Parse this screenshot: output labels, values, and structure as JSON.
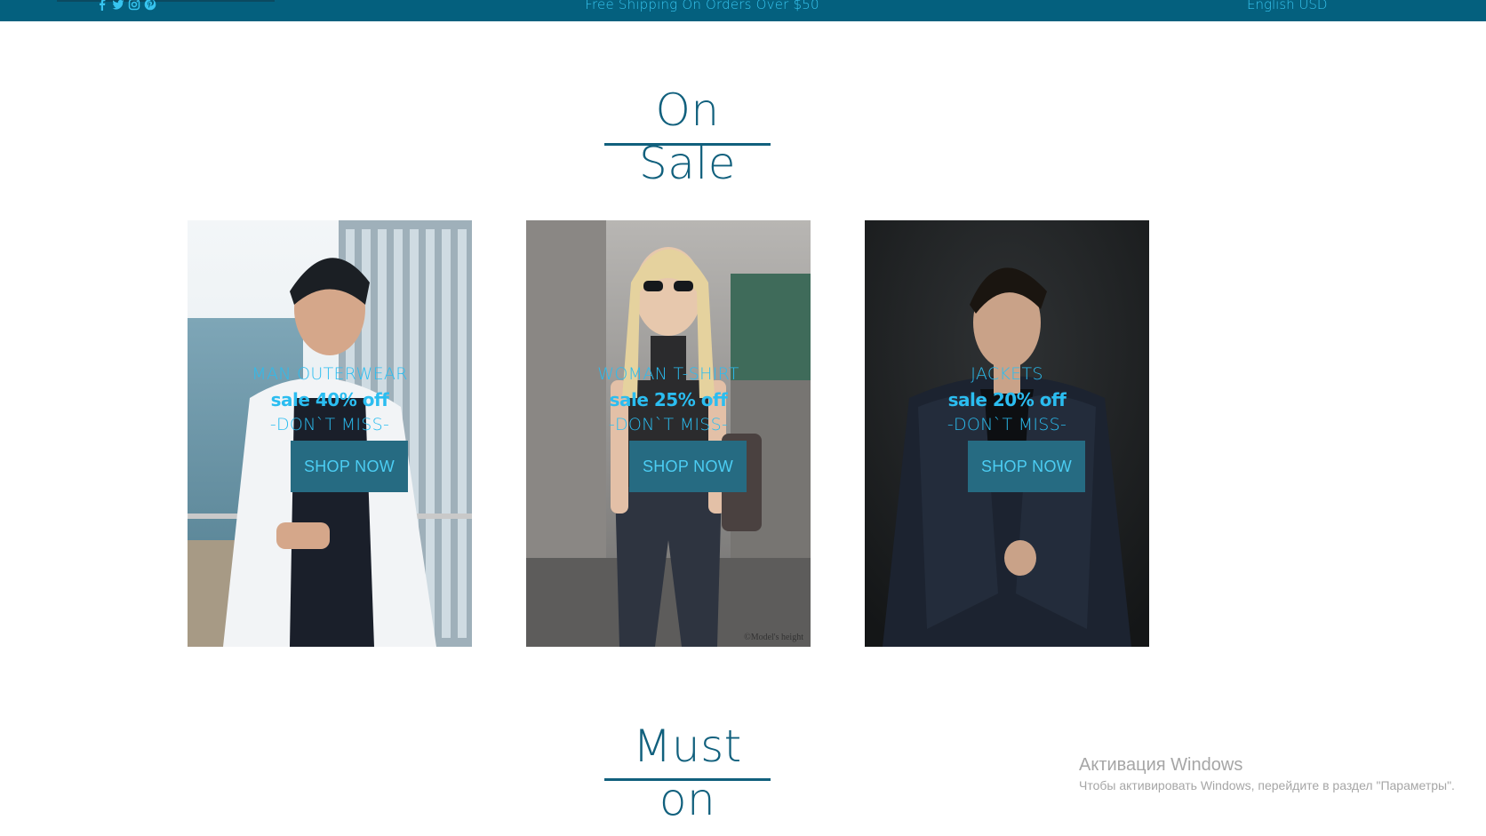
{
  "topbar": {
    "social": [
      "facebook-icon",
      "twitter-icon",
      "instagram-icon",
      "pinterest-icon"
    ],
    "promo": "Free Shipping On Orders Over $50",
    "lang": "English USD"
  },
  "sections": {
    "on_sale_title": "On Sale",
    "must_on_title": "Must on"
  },
  "cards": [
    {
      "category": "MAN OUTERWEAR",
      "sale": "sale 40% off",
      "tagline": "-DON`T MISS-",
      "button": "SHOP NOW",
      "image": "man-balcony-photo"
    },
    {
      "category": "WOMAN T-SHIRT",
      "sale": "sale 25% off",
      "tagline": "-DON`T MISS-",
      "button": "SHOP NOW",
      "image": "woman-street-photo"
    },
    {
      "category": "JACKETS",
      "sale": "sale 20% off",
      "tagline": "-DON`T MISS-",
      "button": "SHOP NOW",
      "image": "man-jacket-photo"
    }
  ],
  "photo_credit": "©Model's height",
  "windows": {
    "title": "Активация Windows",
    "subtitle": "Чтобы активировать Windows, перейдите в раздел \"Параметры\"."
  },
  "colors": {
    "topbar": "#04607e",
    "accent_text": "#37c4ef",
    "title": "#11607d",
    "button_bg": "#266b82"
  }
}
